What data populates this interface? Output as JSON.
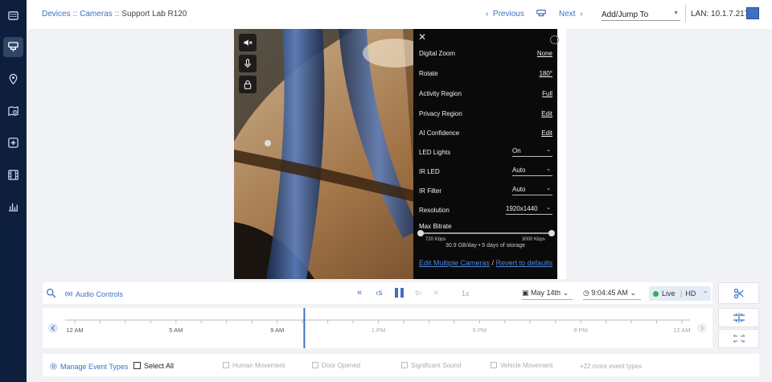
{
  "header": {
    "breadcrumb": [
      "Devices",
      "Cameras",
      "Support Lab R120"
    ],
    "separator": "::",
    "prev_label": "Previous",
    "next_label": "Next",
    "jump_label": "Add/Jump To",
    "lan_label": "LAN: 10.1.7.217"
  },
  "settings": {
    "digital_zoom": {
      "label": "Digital Zoom",
      "value": "None"
    },
    "rotate": {
      "label": "Rotate",
      "value": "180°"
    },
    "activity_region": {
      "label": "Activity Region",
      "value": "Full"
    },
    "privacy_region": {
      "label": "Privacy Region",
      "value": "Edit"
    },
    "ai_confidence": {
      "label": "AI Confidence",
      "value": "Edit"
    },
    "led_lights": {
      "label": "LED Lights",
      "value": "On"
    },
    "ir_led": {
      "label": "IR LED",
      "value": "Auto"
    },
    "ir_filter": {
      "label": "IR Filter",
      "value": "Auto"
    },
    "resolution": {
      "label": "Resolution",
      "value": "1920x1440"
    },
    "max_bitrate": {
      "label": "Max Bitrate",
      "min_label": "720 Kbps",
      "max_label": "3000 Kbps",
      "level": 1.0
    },
    "storage_text": "30.9 GB/day • 5 days of storage",
    "edit_multiple": "Edit Multiple Cameras",
    "slash": "/",
    "revert": "Revert to defaults"
  },
  "controls": {
    "audio_label": "Audio Controls",
    "speed": "1x",
    "date": "May 14th",
    "time": "9:04:45 AM",
    "live_label": "Live",
    "quality_label": "HD",
    "divider": "|"
  },
  "timeline": {
    "labels": [
      "12 AM",
      "5 AM",
      "9 AM",
      "1 PM",
      "5 PM",
      "9 PM",
      "12 AM"
    ],
    "cursor_time": "9:04:45 AM",
    "cursor_position": 0.378
  },
  "events": {
    "manage_label": "Manage Event Types",
    "select_all": "Select All",
    "types": [
      "Human Movement",
      "Door Opened",
      "Significant Sound",
      "Vehicle Movement"
    ],
    "more_label": "+22 more event types"
  },
  "colors": {
    "sidebar": "#0d1f3c",
    "accent": "#3f6fc4",
    "live": "#2eb05d"
  }
}
